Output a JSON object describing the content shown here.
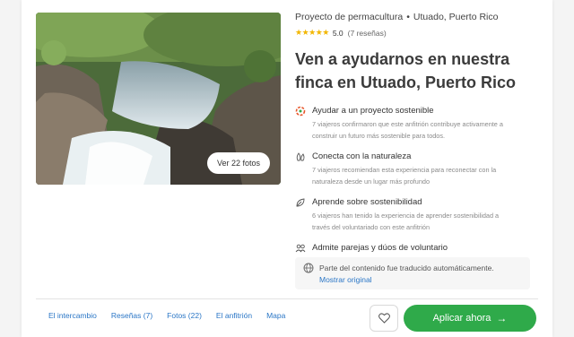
{
  "breadcrumb": {
    "category": "Proyecto de permacultura",
    "separator": "•",
    "location": "Utuado, Puerto Rico"
  },
  "rating": {
    "stars": "★★★★★",
    "score": "5.0",
    "reviews": "(7 reseñas)"
  },
  "title_line1": "Ven a ayudarnos en nuestra",
  "title_line2": "finca en Utuado, Puerto Rico",
  "photos_button": "Ver 22 fotos",
  "features": [
    {
      "icon": "sustainability-icon",
      "title": "Ayudar a un proyecto sostenible",
      "desc_line1": "7 viajeros confirmaron que este anfitrión contribuye activamente a",
      "desc_line2": "construir un futuro más sostenible para todos."
    },
    {
      "icon": "nature-icon",
      "title": "Conecta con la naturaleza",
      "desc_line1": "7 viajeros recomiendan esta experiencia para reconectar con la",
      "desc_line2": "naturaleza desde un lugar más profundo"
    },
    {
      "icon": "leaf-icon",
      "title": "Aprende sobre sostenibilidad",
      "desc_line1": "6 viajeros han tenido la experiencia de aprender sostenibilidad a",
      "desc_line2": "través del voluntariado con este anfitrión"
    },
    {
      "icon": "people-icon",
      "title": "Admite parejas y dúos de voluntario",
      "desc_line1": "",
      "desc_line2": ""
    }
  ],
  "notice": {
    "text": "Parte del contenido fue traducido automáticamente.",
    "link": "Mostrar original"
  },
  "tabs": [
    "El intercambio",
    "Reseñas (7)",
    "Fotos (22)",
    "El anfitrión",
    "Mapa"
  ],
  "apply_button": "Aplicar ahora",
  "colors": {
    "accent_green": "#2faa4a",
    "link_blue": "#2a76c6",
    "star_yellow": "#f2b600"
  }
}
